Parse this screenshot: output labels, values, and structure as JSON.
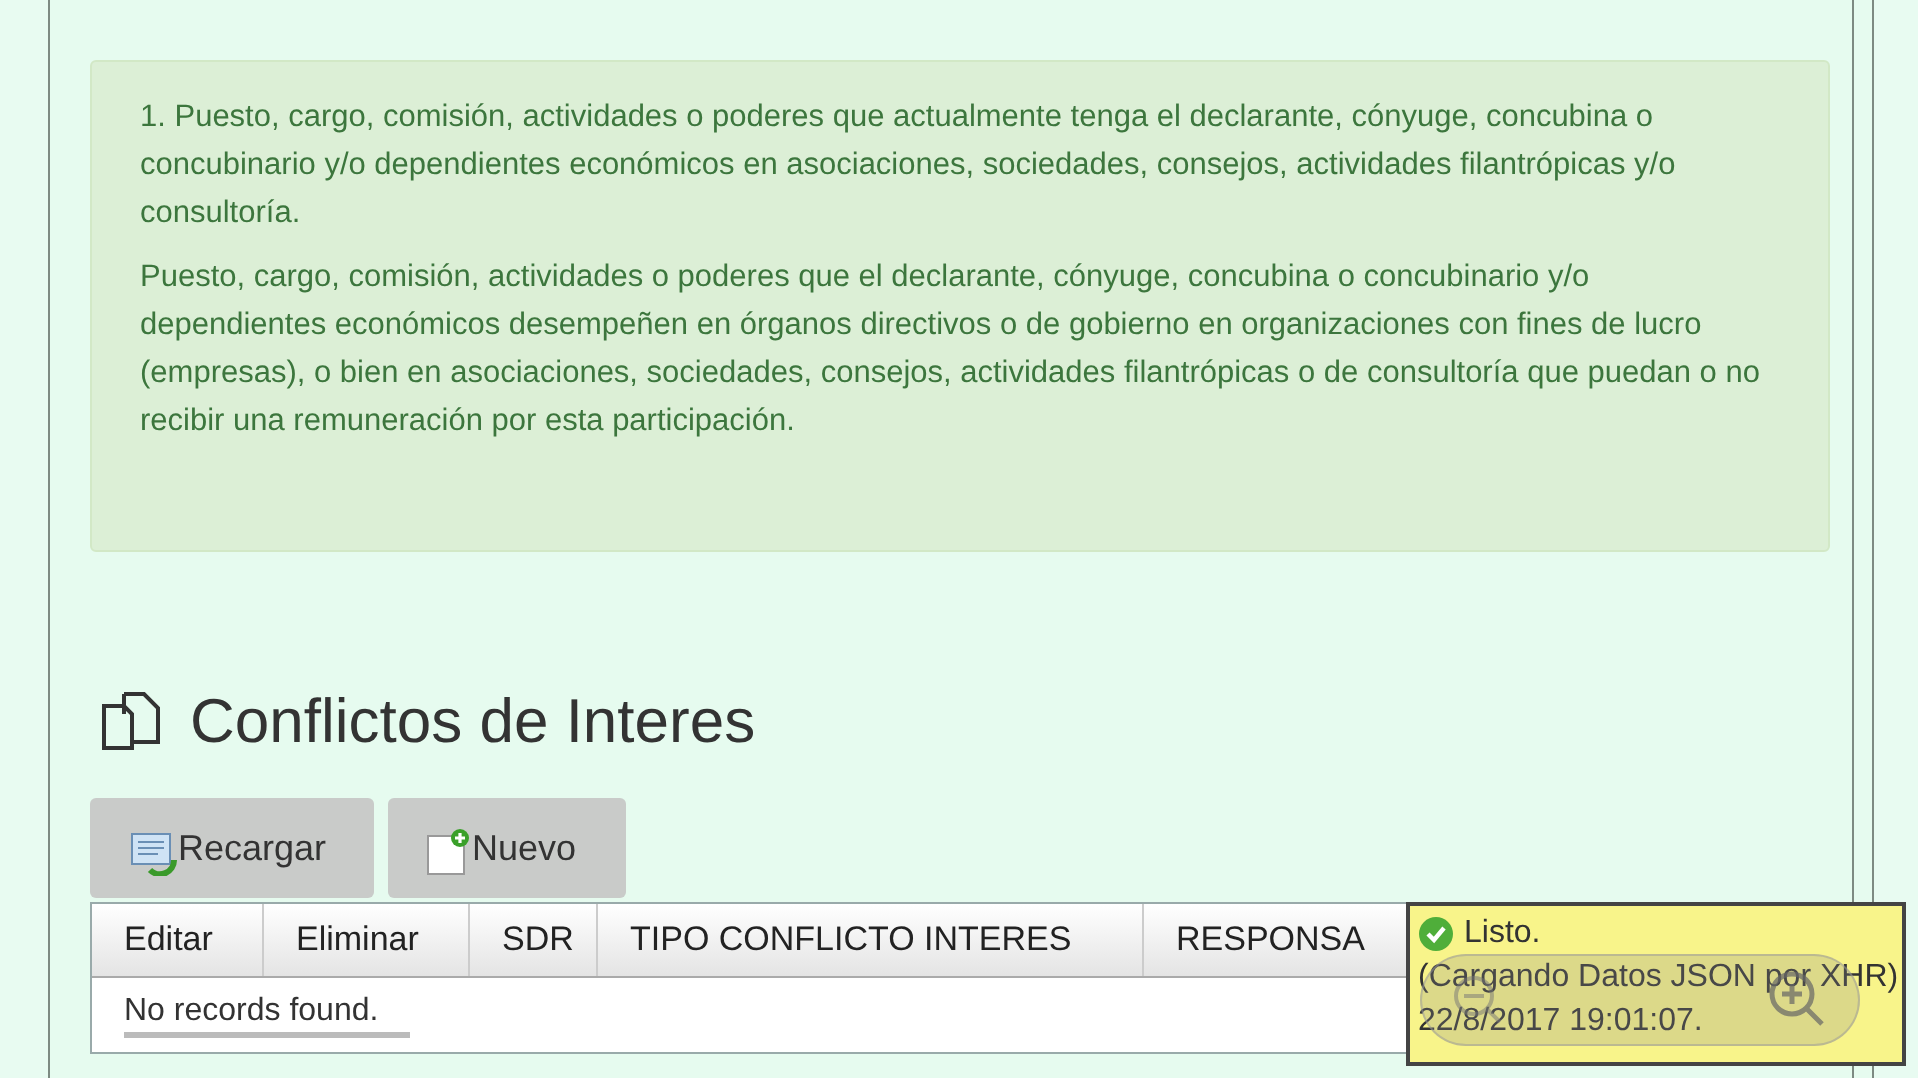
{
  "alert": {
    "paragraphs": [
      "1. Puesto, cargo, comisión, actividades o poderes que actualmente tenga el declarante, cónyuge, concubina o concubinario y/o dependientes económicos en asociaciones, sociedades, consejos, actividades filantrópicas y/o consultoría.",
      "Puesto, cargo, comisión, actividades o poderes que el declarante, cónyuge, concubina o concubinario y/o dependientes económicos desempeñen en órganos directivos o de gobierno en organizaciones con fines de lucro (empresas), o bien en asociaciones, sociedades, consejos, actividades filantrópicas o de consultoría que puedan o no recibir una remuneración por esta participación."
    ]
  },
  "section": {
    "title": "Conflictos de Interes"
  },
  "buttons": [
    {
      "kind": "reload",
      "label": "Recargar"
    },
    {
      "kind": "new",
      "label": "Nuevo"
    }
  ],
  "table": {
    "columns": [
      "Editar",
      "Eliminar",
      "SDR",
      "TIPO CONFLICTO INTERES",
      "RESPONSA"
    ],
    "empty_message": "No records found."
  },
  "notification": {
    "title": "Listo.",
    "lines": [
      "(Cargando Datos JSON por XHR)",
      "22/8/2017 19:01:07."
    ]
  }
}
